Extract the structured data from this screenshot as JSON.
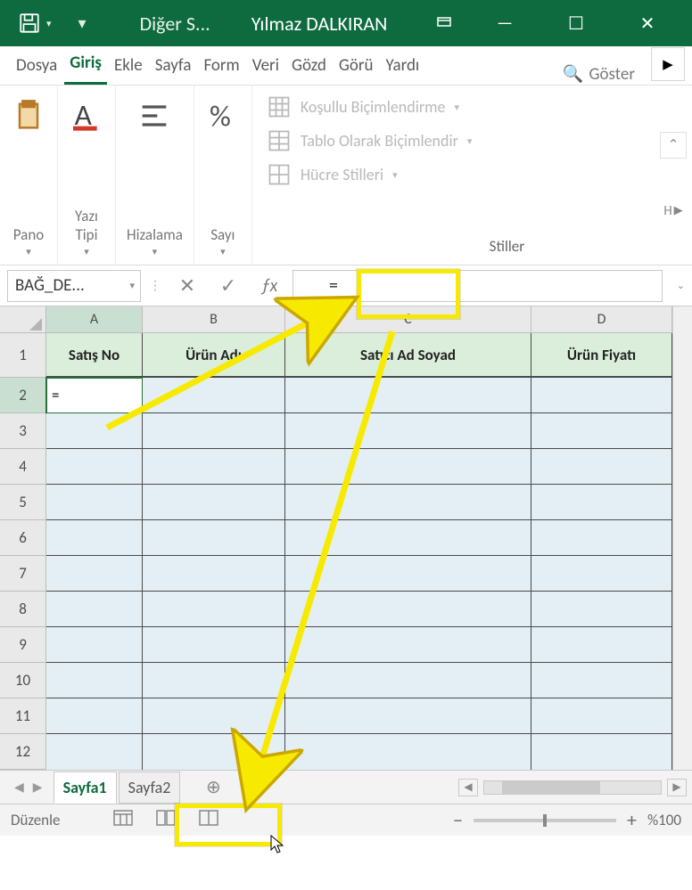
{
  "titlebar": {
    "doc_label": "Diğer S...",
    "user": "Yılmaz DALKIRAN"
  },
  "ribbon_tabs": {
    "file": "Dosya",
    "home": "Giriş",
    "insert": "Ekle",
    "page": "Sayfa",
    "form": "Form",
    "data": "Veri",
    "review": "Gözd",
    "view": "Görü",
    "help": "Yardı",
    "search": "Göster"
  },
  "ribbon_groups": {
    "clipboard": "Pano",
    "font": "Yazı\nTipi",
    "alignment": "Hizalama",
    "number": "Sayı",
    "styles": {
      "conditional": "Koşullu Biçimlendirme",
      "table": "Tablo Olarak Biçimlendir",
      "cell": "Hücre Stilleri",
      "label": "Stiller"
    },
    "h_label": "H"
  },
  "formula_bar": {
    "name_box": "BAĞ_DE...",
    "value": "="
  },
  "columns": {
    "A": "A",
    "B": "B",
    "C": "C",
    "D": "D"
  },
  "headers": {
    "A": "Satış No",
    "B": "Ürün Adı",
    "C": "Satıcı Ad Soyad",
    "D": "Ürün Fiyatı"
  },
  "rows": [
    "1",
    "2",
    "3",
    "4",
    "5",
    "6",
    "7",
    "8",
    "9",
    "10",
    "11",
    "12"
  ],
  "active_cell_value": "=",
  "sheets": {
    "s1": "Sayfa1",
    "s2": "Sayfa2"
  },
  "sheet_add": "⊕",
  "status": {
    "mode": "Düzenle",
    "zoom": "%100"
  }
}
